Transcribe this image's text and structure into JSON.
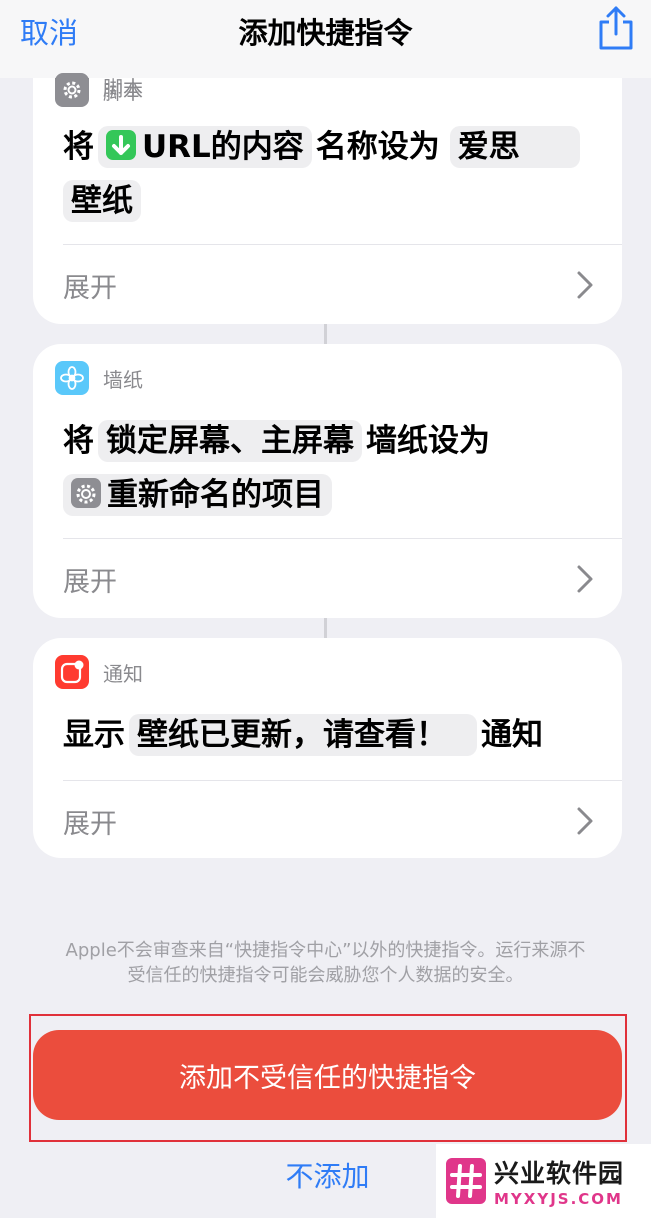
{
  "navbar": {
    "cancel_label": "取消",
    "title": "添加快捷指令",
    "share_icon": "share-icon"
  },
  "actions": [
    {
      "name": "脚本",
      "icon": "gear-icon",
      "icon_color": "#8e8e93",
      "text_before": "将",
      "chip1_icon": "download-arrow-icon",
      "chip1_icon_color": "#34c759",
      "chip1": "URL的内容",
      "text_middle": "名称设为",
      "chip2_line1": "爱思",
      "chip2_line2": "壁纸",
      "expand_label": "展开"
    },
    {
      "name": "墙纸",
      "icon": "flower-icon",
      "icon_color": "#5ac8fa",
      "text_before": "将",
      "chip1": "锁定屏幕、主屏幕",
      "text_middle": "墙纸设为",
      "chip2_icon": "gear-icon",
      "chip2": "重新命名的项目",
      "expand_label": "展开"
    },
    {
      "name": "通知",
      "icon": "notification-icon",
      "icon_color": "#ff3b30",
      "text_before": "显示",
      "chip1": "壁纸已更新，请查看！",
      "text_after": "通知",
      "expand_label": "展开"
    }
  ],
  "footnote": {
    "line1": "Apple不会审查来自“快捷指令中心”以外的快捷指令。运行来源不",
    "line2": "受信任的快捷指令可能会威胁您个人数据的安全。"
  },
  "buttons": {
    "add_untrusted": "添加不受信任的快捷指令",
    "do_not_add": "不添加"
  },
  "colors": {
    "accent_blue": "#2f7cf6",
    "primary_red": "#eb4d3d",
    "highlight_border": "#e0303a"
  },
  "watermark": {
    "name": "兴业软件园",
    "url": "MYXYJS.COM"
  }
}
